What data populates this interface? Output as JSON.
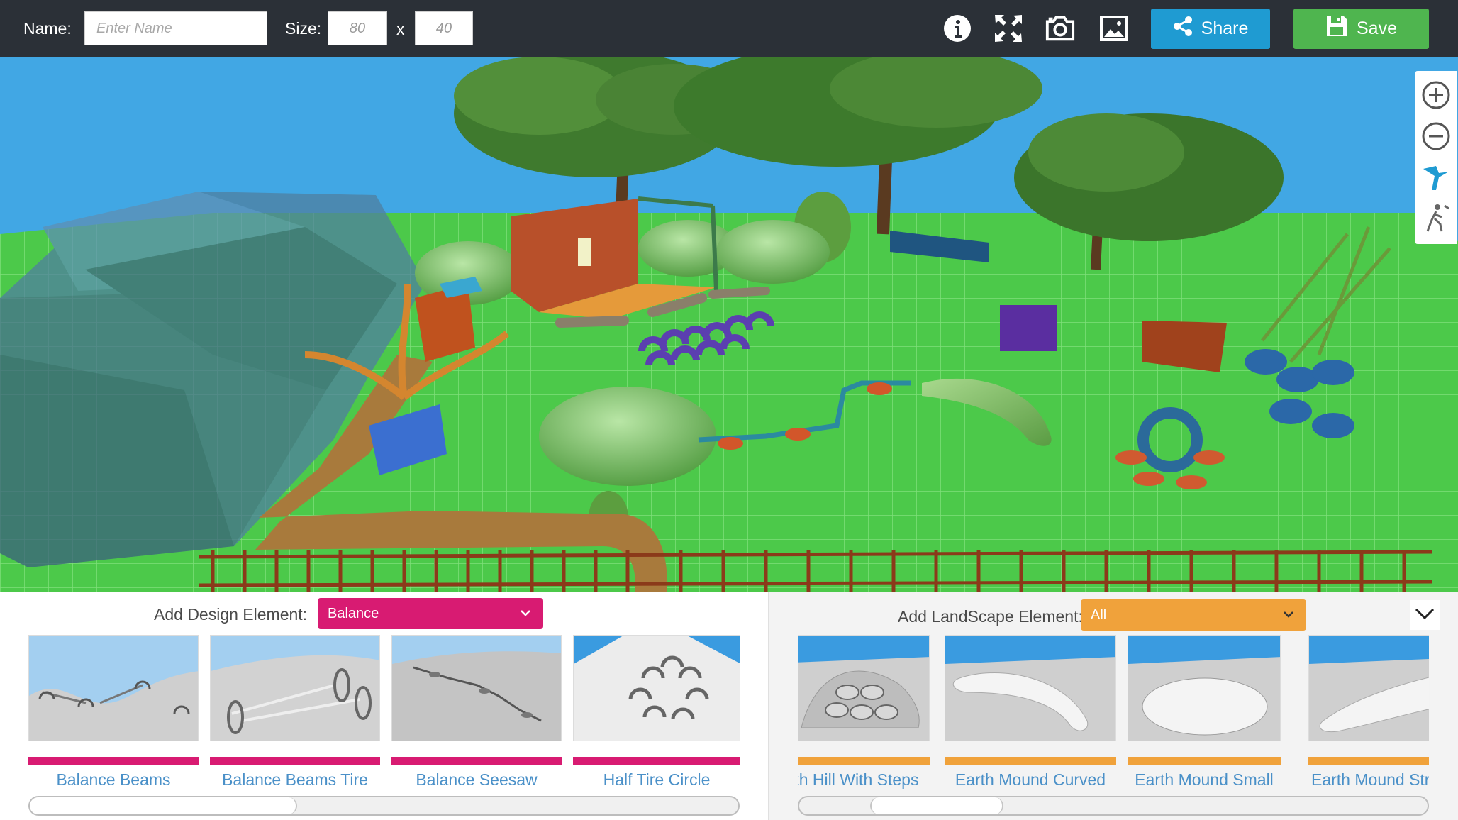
{
  "toolbar": {
    "name_label": "Name:",
    "name_placeholder": "Enter Name",
    "size_label": "Size:",
    "width_value": "80",
    "times_symbol": "x",
    "height_value": "40",
    "share_label": "Share",
    "save_label": "Save",
    "icons": [
      "info-icon",
      "fullscreen-icon",
      "camera-icon",
      "image-icon",
      "share-icon",
      "floppy-disk-icon"
    ]
  },
  "nav_tools": [
    "zoom-in-icon",
    "zoom-out-icon",
    "fly-view-icon",
    "walk-view-icon"
  ],
  "design_panel": {
    "label": "Add Design Element:",
    "selected": "Balance",
    "accent": "#d81b72",
    "items": [
      {
        "name": "Balance Beams"
      },
      {
        "name": "Balance Beams Tire"
      },
      {
        "name": "Balance Seesaw"
      },
      {
        "name": "Half Tire Circle"
      }
    ]
  },
  "landscape_panel": {
    "label": "Add LandScape Element:",
    "selected": "All",
    "accent": "#f0a23b",
    "items": [
      {
        "name": "Earth Hill With Steps"
      },
      {
        "name": "Earth Mound Curved"
      },
      {
        "name": "Earth Mound Small"
      },
      {
        "name": "Earth Mound Straight"
      }
    ]
  },
  "colors": {
    "topbar": "#2b3037",
    "sky": "#41a7e4",
    "grass": "#4cc94a",
    "share": "#1f9bd2",
    "save": "#4fb54f",
    "label_text": "#4a90c8"
  }
}
